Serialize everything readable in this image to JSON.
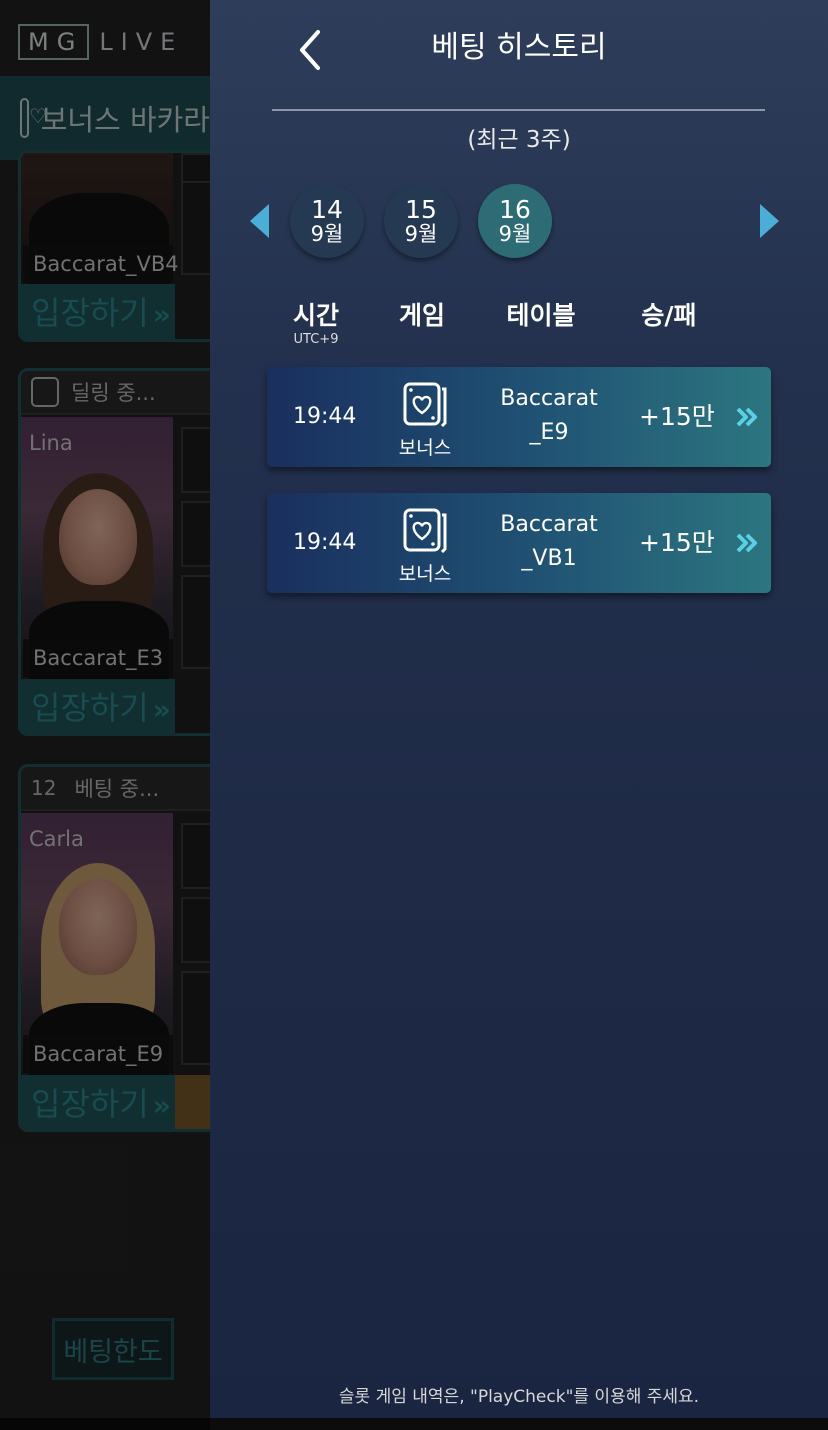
{
  "lobby": {
    "logo_mg": "MG",
    "logo_live": "LIVE",
    "category_label": "보너스 바카라",
    "cards": [
      {
        "head": "",
        "dealer": "",
        "table": "Baccarat_VB4",
        "enter": "입장하기"
      },
      {
        "head": "딜링 중...",
        "dealer": "Lina",
        "table": "Baccarat_E3",
        "enter": "입장하기"
      },
      {
        "head_num": "12",
        "head": "베팅 중...",
        "dealer": "Carla",
        "table": "Baccarat_E9",
        "enter": "입장하기"
      }
    ],
    "limit_button": "베팅한도"
  },
  "panel": {
    "title": "베팅 히스토리",
    "subtitle": "(최근 3주)",
    "dates": [
      {
        "day": "14",
        "month": "9월",
        "active": false
      },
      {
        "day": "15",
        "month": "9월",
        "active": false
      },
      {
        "day": "16",
        "month": "9월",
        "active": true
      }
    ],
    "columns": {
      "time": "시간",
      "time_sub": "UTC+9",
      "game": "게임",
      "table": "테이블",
      "result": "승/패"
    },
    "rows": [
      {
        "time": "19:44",
        "game": "보너스",
        "table_line1": "Baccarat",
        "table_line2": "_E9",
        "result": "+15만"
      },
      {
        "time": "19:44",
        "game": "보너스",
        "table_line1": "Baccarat",
        "table_line2": "_VB1",
        "result": "+15만"
      }
    ],
    "footer": "슬롯 게임 내역은, \"PlayCheck\"를 이용해 주세요."
  },
  "colors": {
    "accent": "#4aaed6",
    "active_date": "#2e6c75",
    "row_gradient_start": "#1a2f5e",
    "row_gradient_end": "#2c7680"
  }
}
